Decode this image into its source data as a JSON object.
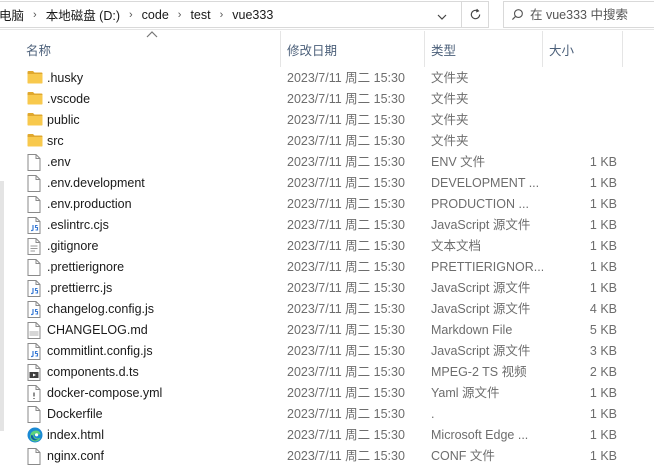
{
  "breadcrumb": {
    "items": [
      "电脑",
      "本地磁盘 (D:)",
      "code",
      "test",
      "vue333"
    ],
    "separator": "›"
  },
  "search": {
    "placeholder": "在 vue333 中搜索"
  },
  "icons": {
    "dropdown": "chevron-down-icon",
    "refresh": "refresh-icon",
    "search": "search-icon",
    "folder": "folder-icon",
    "file": "file-icon",
    "edge": "edge-browser-icon"
  },
  "colors": {
    "header_text": "#4c607a",
    "folder": "#f8c94d",
    "folder_dark": "#e0a82e",
    "secondary_text": "#6d6d6d",
    "hover": "#e5f3ff"
  },
  "columns": {
    "name": "名称",
    "date": "修改日期",
    "type": "类型",
    "size": "大小"
  },
  "files": [
    {
      "name": ".husky",
      "date": "2023/7/11 周二 15:30",
      "type": "文件夹",
      "size": "",
      "icon": "folder"
    },
    {
      "name": ".vscode",
      "date": "2023/7/11 周二 15:30",
      "type": "文件夹",
      "size": "",
      "icon": "folder"
    },
    {
      "name": "public",
      "date": "2023/7/11 周二 15:30",
      "type": "文件夹",
      "size": "",
      "icon": "folder"
    },
    {
      "name": "src",
      "date": "2023/7/11 周二 15:30",
      "type": "文件夹",
      "size": "",
      "icon": "folder"
    },
    {
      "name": ".env",
      "date": "2023/7/11 周二 15:30",
      "type": "ENV 文件",
      "size": "1 KB",
      "icon": "file"
    },
    {
      "name": ".env.development",
      "date": "2023/7/11 周二 15:30",
      "type": "DEVELOPMENT ...",
      "size": "1 KB",
      "icon": "file"
    },
    {
      "name": ".env.production",
      "date": "2023/7/11 周二 15:30",
      "type": "PRODUCTION ...",
      "size": "1 KB",
      "icon": "file"
    },
    {
      "name": ".eslintrc.cjs",
      "date": "2023/7/11 周二 15:30",
      "type": "JavaScript 源文件",
      "size": "1 KB",
      "icon": "js"
    },
    {
      "name": ".gitignore",
      "date": "2023/7/11 周二 15:30",
      "type": "文本文档",
      "size": "1 KB",
      "icon": "text"
    },
    {
      "name": ".prettierignore",
      "date": "2023/7/11 周二 15:30",
      "type": "PRETTIERIGNOR...",
      "size": "1 KB",
      "icon": "file"
    },
    {
      "name": ".prettierrc.js",
      "date": "2023/7/11 周二 15:30",
      "type": "JavaScript 源文件",
      "size": "1 KB",
      "icon": "js"
    },
    {
      "name": "changelog.config.js",
      "date": "2023/7/11 周二 15:30",
      "type": "JavaScript 源文件",
      "size": "4 KB",
      "icon": "js"
    },
    {
      "name": "CHANGELOG.md",
      "date": "2023/7/11 周二 15:30",
      "type": "Markdown File",
      "size": "5 KB",
      "icon": "md"
    },
    {
      "name": "commitlint.config.js",
      "date": "2023/7/11 周二 15:30",
      "type": "JavaScript 源文件",
      "size": "3 KB",
      "icon": "js"
    },
    {
      "name": "components.d.ts",
      "date": "2023/7/11 周二 15:30",
      "type": "MPEG-2 TS 视频",
      "size": "2 KB",
      "icon": "video"
    },
    {
      "name": "docker-compose.yml",
      "date": "2023/7/11 周二 15:30",
      "type": "Yaml 源文件",
      "size": "1 KB",
      "icon": "yaml"
    },
    {
      "name": "Dockerfile",
      "date": "2023/7/11 周二 15:30",
      "type": ".",
      "size": "1 KB",
      "icon": "file"
    },
    {
      "name": "index.html",
      "date": "2023/7/11 周二 15:30",
      "type": "Microsoft Edge ...",
      "size": "1 KB",
      "icon": "edge"
    },
    {
      "name": "nginx.conf",
      "date": "2023/7/11 周二 15:30",
      "type": "CONF 文件",
      "size": "1 KB",
      "icon": "file"
    }
  ]
}
